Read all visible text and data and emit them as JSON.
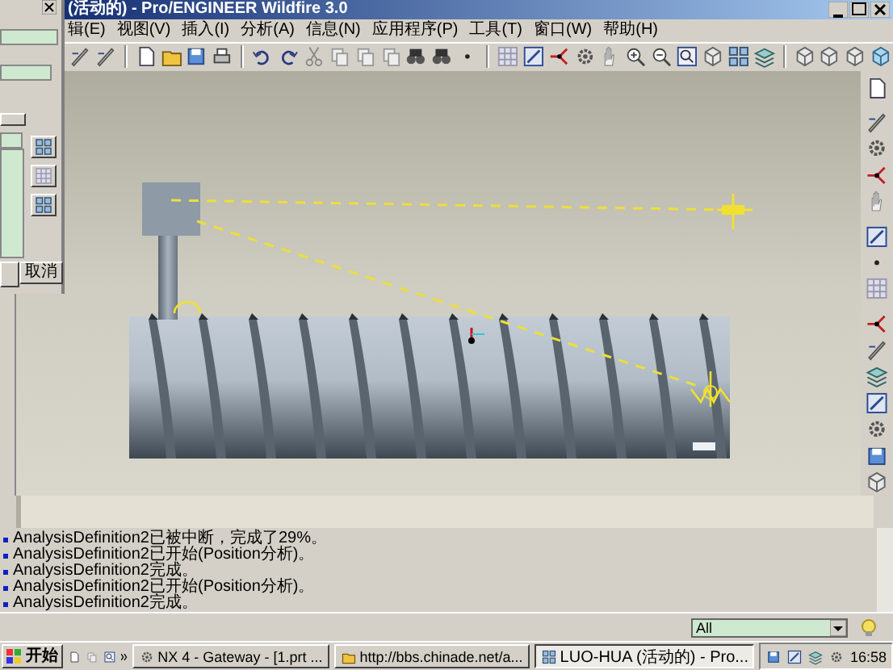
{
  "window": {
    "title": "(活动的) - Pro/ENGINEER Wildfire 3.0"
  },
  "menu": [
    "辑(E)",
    "视图(V)",
    "插入(I)",
    "分析(A)",
    "信息(N)",
    "应用程序(P)",
    "工具(T)",
    "窗口(W)",
    "帮助(H)"
  ],
  "dialog": {
    "cancel_button": "取消"
  },
  "messages": [
    "AnalysisDefinition2已被中断，完成了29%。",
    "AnalysisDefinition2已开始(Position分析)。",
    "AnalysisDefinition2完成。",
    "AnalysisDefinition2已开始(Position分析)。",
    "AnalysisDefinition2完成。"
  ],
  "filter": {
    "value": "All"
  },
  "taskbar": {
    "start": "开始",
    "tasks": [
      {
        "label": "NX 4 - Gateway - [1.prt ...",
        "selected": false
      },
      {
        "label": "http://bbs.chinade.net/a...",
        "selected": false
      },
      {
        "label": "LUO-HUA (活动的) - Pro...",
        "selected": true
      }
    ],
    "clock": "16:58"
  }
}
